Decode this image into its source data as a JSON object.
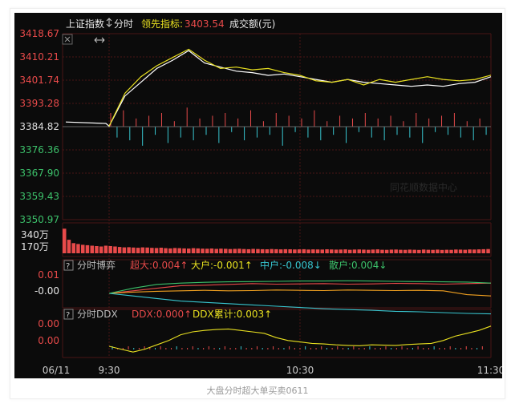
{
  "header": {
    "index_name": "上证指数",
    "period": "分时",
    "leading_label": "领先指标:",
    "leading_value": "3403.54",
    "volume_label": "成交额(元)"
  },
  "caption": "大盘分时超大单买卖0611",
  "watermark": "同花顺数据中心",
  "panels": {
    "flow": {
      "title": "分时博弈",
      "chaoda": "超大:0.004↑",
      "dahu": "大户:-0.001↑",
      "zhonghu": "中户:-0.008↓",
      "sanhu": "散户:0.004↓",
      "ticks": [
        "0.01",
        "-0.00"
      ]
    },
    "ddx": {
      "title": "分时DDX",
      "ddx": "DDX:0.000↑",
      "ddx_sum": "DDX累计:0.003↑",
      "ticks": [
        "0.00",
        "0.00"
      ]
    }
  },
  "colors": {
    "up": "#e84a4a",
    "down": "#38c6d0",
    "flat": "#dddddd",
    "green": "#3cc06a",
    "yellow": "#e8e020",
    "orange": "#f0a020",
    "white": "#ffffff",
    "background": "#0b0b0b",
    "grid": "#4a1414"
  },
  "chart_data": [
    {
      "type": "line",
      "name": "intraday-price",
      "x_ticks": [
        "06/11",
        "9:30",
        "10:30",
        "11:30"
      ],
      "y_ticks": [
        "3418.67",
        "3410.21",
        "3401.74",
        "3393.28",
        "3384.82",
        "3376.36",
        "3367.90",
        "3359.43",
        "3350.97"
      ],
      "ylim": [
        3350.97,
        3418.67
      ],
      "prev_close": 3384.82,
      "x": [
        "06/11 close",
        "",
        "9:30",
        "9:35",
        "9:40",
        "9:45",
        "9:50",
        "9:55",
        "10:00",
        "10:05",
        "10:10",
        "10:15",
        "10:20",
        "10:25",
        "10:30",
        "10:35",
        "10:40",
        "10:45",
        "10:50",
        "10:55",
        "11:00",
        "11:05",
        "11:10",
        "11:15",
        "11:20",
        "11:25",
        "11:30"
      ],
      "series": [
        {
          "color": "white",
          "values": [
            3386.5,
            3386.0,
            3385.0,
            3396.0,
            3401.0,
            3406.0,
            3409.0,
            3412.5,
            3408.0,
            3406.5,
            3405.0,
            3404.5,
            3403.5,
            3404.0,
            3403.0,
            3402.0,
            3401.0,
            3402.0,
            3401.0,
            3400.5,
            3400.0,
            3399.5,
            3400.0,
            3399.5,
            3400.5,
            3401.0,
            3403.0
          ]
        },
        {
          "color": "yellow",
          "values": [
            null,
            null,
            3385.0,
            3397.0,
            3403.0,
            3407.0,
            3410.0,
            3413.0,
            3409.0,
            3406.0,
            3406.5,
            3405.5,
            3406.0,
            3404.5,
            3403.5,
            3401.5,
            3401.0,
            3402.0,
            3400.0,
            3402.0,
            3401.0,
            3402.0,
            3403.0,
            3402.0,
            3401.5,
            3402.0,
            3403.54
          ]
        }
      ],
      "breadth_bars": [
        5,
        -4,
        6,
        -5,
        3,
        -7,
        4,
        -3,
        5,
        -6,
        2,
        -4,
        7,
        -5,
        3,
        -3,
        4,
        -6,
        5,
        -2,
        3,
        -5,
        6,
        -4,
        2,
        -3,
        5,
        -7,
        4,
        -2,
        3,
        -4,
        6,
        -5,
        2,
        -3,
        4,
        -6,
        3,
        -2,
        5,
        -4,
        3,
        -5,
        4,
        -3,
        2,
        -4,
        5,
        -6,
        3,
        -2,
        4,
        -3,
        5,
        -4,
        2,
        -5,
        3,
        -3
      ]
    },
    {
      "type": "bar",
      "name": "turnover",
      "y_ticks": [
        "340万",
        "170万"
      ],
      "ylim": [
        0,
        340
      ],
      "unit": "万",
      "values": [
        290,
        160,
        120,
        110,
        100,
        95,
        90,
        85,
        80,
        90,
        85,
        80,
        75,
        70,
        72,
        68,
        65,
        70,
        68,
        64,
        62,
        66,
        60,
        58,
        62,
        60,
        58,
        56,
        60,
        58,
        55,
        54,
        57,
        52,
        55,
        53,
        50,
        52,
        54,
        50,
        48,
        52,
        50,
        48,
        47,
        50,
        48,
        46,
        48,
        47,
        45,
        46,
        48,
        44,
        46,
        45,
        44,
        47,
        45,
        43,
        44,
        46,
        42,
        44,
        45,
        43,
        42,
        44,
        46,
        42,
        41,
        43,
        44,
        42,
        41,
        43,
        42,
        40,
        44,
        42,
        41,
        43,
        40,
        42,
        41,
        44,
        43,
        42,
        45,
        44,
        46,
        48,
        50
      ]
    },
    {
      "type": "line",
      "name": "order-flow",
      "series": [
        {
          "name": "超大",
          "color": "red",
          "values": [
            0,
            1,
            2,
            3,
            3.2,
            3.5,
            3.8,
            3.6,
            3.7,
            3.8,
            3.6,
            3.7,
            3.9,
            3.8,
            3.6,
            3.8,
            4.0
          ]
        },
        {
          "name": "大户",
          "color": "orange",
          "values": [
            0,
            0.5,
            0.8,
            1.0,
            1.2,
            1.0,
            1.1,
            1.3,
            1.2,
            1.1,
            1.3,
            1.2,
            1.1,
            1.2,
            1.0,
            -0.5,
            -1.0
          ]
        },
        {
          "name": "中户",
          "color": "cyan",
          "values": [
            0,
            -1,
            -2,
            -3,
            -3.5,
            -4,
            -4.5,
            -5,
            -5.5,
            -6,
            -6.3,
            -6.6,
            -7,
            -7.2,
            -7.5,
            -7.8,
            -8.0
          ]
        },
        {
          "name": "散户",
          "color": "green",
          "values": [
            0,
            2,
            3.5,
            4,
            4.3,
            4.5,
            4.6,
            4.7,
            4.8,
            4.8,
            4.9,
            4.8,
            4.7,
            4.6,
            4.5,
            4.4,
            4.0
          ]
        }
      ]
    },
    {
      "type": "line",
      "name": "ddx",
      "series": [
        {
          "name": "DDX累计",
          "color": "yellow",
          "values": [
            0,
            -1,
            -2,
            -1,
            0.5,
            2,
            4,
            5,
            5.5,
            5.8,
            6,
            5.5,
            5,
            4.5,
            3,
            2,
            1.5,
            1,
            0.8,
            0.5,
            0.3,
            0.2,
            0.5,
            0.4,
            0.3,
            0.6,
            0.8,
            1,
            2,
            3.5,
            4.5,
            5.5,
            7
          ]
        }
      ]
    }
  ]
}
